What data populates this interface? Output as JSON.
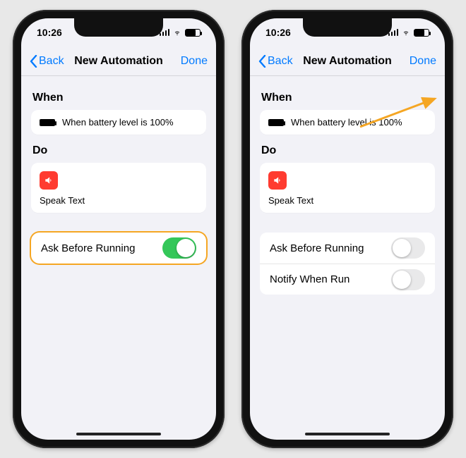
{
  "phones": [
    {
      "status": {
        "time": "10:26"
      },
      "nav": {
        "back": "Back",
        "title": "New Automation",
        "done": "Done"
      },
      "sections": {
        "when_label": "When",
        "when_condition": "When battery level is 100%",
        "do_label": "Do",
        "do_action": "Speak Text"
      },
      "options": [
        {
          "label": "Ask Before Running",
          "on": true
        }
      ],
      "highlight_options": true,
      "arrow_to_done": false
    },
    {
      "status": {
        "time": "10:26"
      },
      "nav": {
        "back": "Back",
        "title": "New Automation",
        "done": "Done"
      },
      "sections": {
        "when_label": "When",
        "when_condition": "When battery level is 100%",
        "do_label": "Do",
        "do_action": "Speak Text"
      },
      "options": [
        {
          "label": "Ask Before Running",
          "on": false
        },
        {
          "label": "Notify When Run",
          "on": false
        }
      ],
      "highlight_options": false,
      "arrow_to_done": true
    }
  ]
}
